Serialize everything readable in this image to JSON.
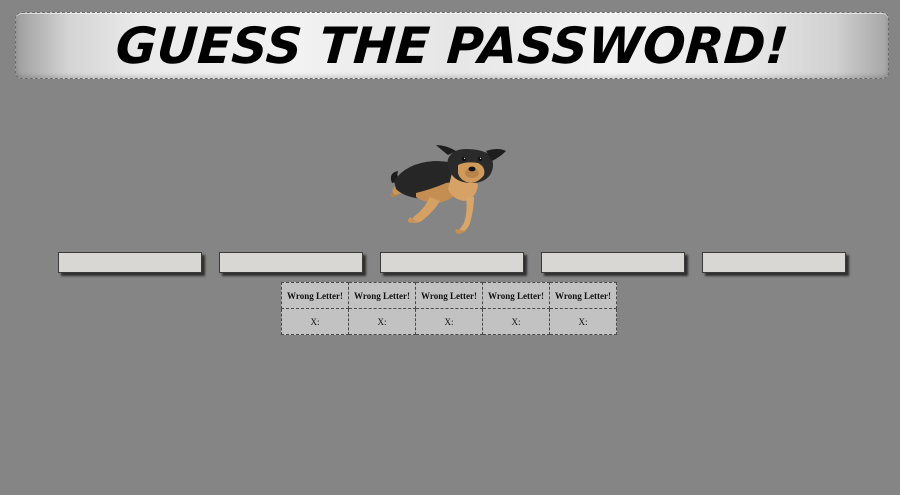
{
  "header": {
    "title": "GUESS THE PASSWORD!"
  },
  "image": {
    "subject": "dog-image"
  },
  "password_slots": [
    "",
    "",
    "",
    "",
    ""
  ],
  "wrong_letters": {
    "headers": [
      "Wrong Letter!",
      "Wrong Letter!",
      "Wrong Letter!",
      "Wrong Letter!",
      "Wrong Letter!"
    ],
    "values": [
      "X:",
      "X:",
      "X:",
      "X:",
      "X:"
    ]
  },
  "colors": {
    "background": "#858585",
    "slot_fill": "#d9d7d3",
    "table_fill": "#c2c2c2"
  }
}
